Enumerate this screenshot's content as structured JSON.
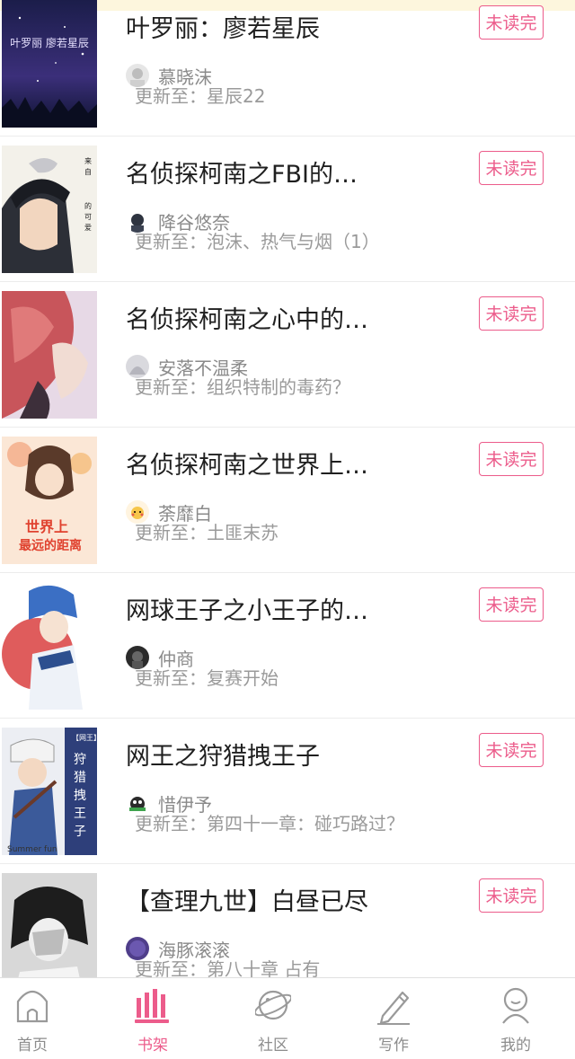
{
  "colors": {
    "accent": "#ec5c8b",
    "text_primary": "#1f1f1f",
    "text_secondary": "#8a8a8a",
    "top_strip": "#fdf6dd"
  },
  "books": [
    {
      "title": "叶罗丽：廖若星辰",
      "author": "慕晓沫",
      "update": "更新至：星辰22",
      "status": "未读完",
      "cover_text": "叶罗丽 廖若星辰"
    },
    {
      "title": "名侦探柯南之FBI的…",
      "author": "降谷悠奈",
      "update": "更新至：泡沫、热气与烟（1）",
      "status": "未读完",
      "cover_text": "来自FBI的可爱少女"
    },
    {
      "title": "名侦探柯南之心中的…",
      "author": "安落不温柔",
      "update": "更新至：组织特制的毒药？",
      "status": "未读完"
    },
    {
      "title": "名侦探柯南之世界上…",
      "author": "荼靡白",
      "update": "更新至：土匪末苏",
      "status": "未读完",
      "cover_text": "世界上最远的距离"
    },
    {
      "title": "网球王子之小王子的…",
      "author": "仲商",
      "update": "更新至：复赛开始",
      "status": "未读完"
    },
    {
      "title": "网王之狩猎拽王子",
      "author": "惜伊予",
      "update": "更新至：第四十一章：碰巧路过？",
      "status": "未读完",
      "cover_text": "【网王】狩猎拽王子 惜伊予 Summer fun"
    },
    {
      "title": "【查理九世】白昼已尽",
      "author": "海豚滚滚",
      "update": "更新至：第八十章 占有",
      "status": "未读完"
    }
  ],
  "tabbar": {
    "tabs": [
      {
        "label": "首页",
        "icon": "home-icon"
      },
      {
        "label": "书架",
        "icon": "bookshelf-icon",
        "active": true
      },
      {
        "label": "社区",
        "icon": "planet-icon"
      },
      {
        "label": "写作",
        "icon": "pencil-icon"
      },
      {
        "label": "我的",
        "icon": "profile-icon"
      }
    ]
  }
}
